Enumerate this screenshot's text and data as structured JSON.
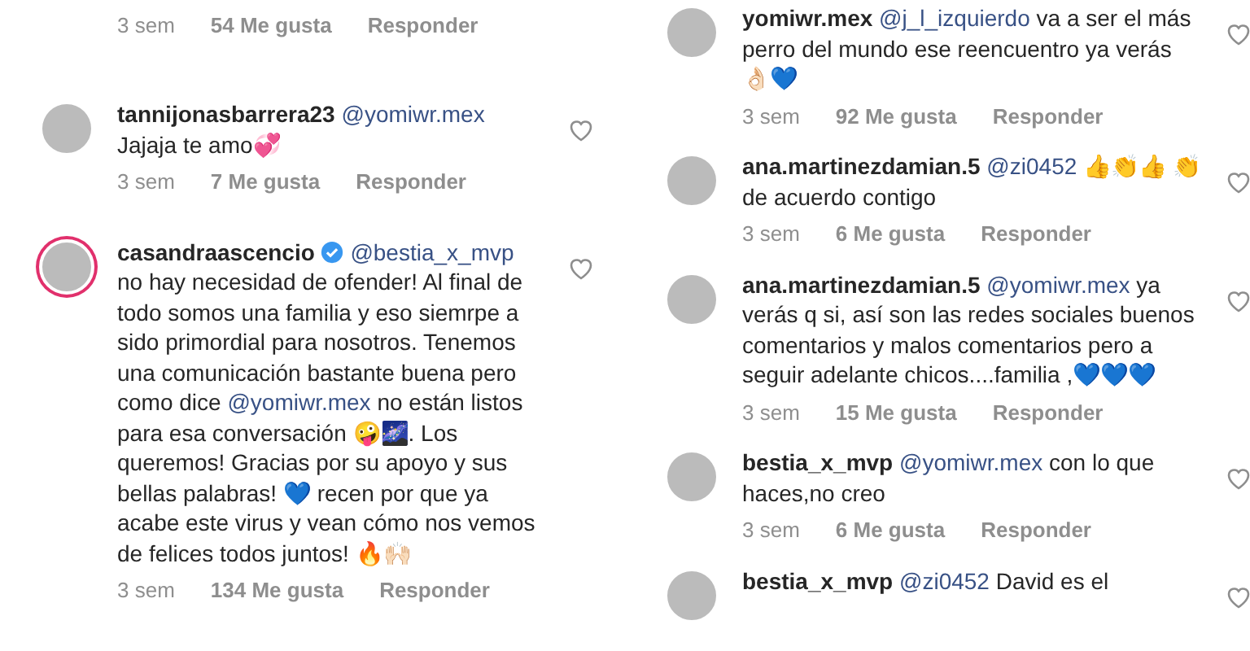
{
  "columns": [
    {
      "comments": [
        {
          "meta": {
            "time": "3 sem",
            "likes": "54 Me gusta",
            "reply": "Responder"
          }
        },
        {
          "username": "tannijonasbarrera23",
          "segments": [
            {
              "kind": "mention",
              "text": "@yomiwr.mex"
            },
            {
              "kind": "plain",
              "text": "Jajaja te amo💞"
            }
          ],
          "meta": {
            "time": "3 sem",
            "likes": "7 Me gusta",
            "reply": "Responder"
          }
        },
        {
          "username": "casandraascencio",
          "verified": true,
          "segments": [
            {
              "kind": "mention",
              "text": "@bestia_x_mvp"
            },
            {
              "kind": "plain",
              "text": "no hay necesidad de ofender! Al final de todo somos una familia y eso siemrpe a sido primordial para nosotros. Tenemos una comunicación bastante buena pero como dice"
            },
            {
              "kind": "mention",
              "text": "@yomiwr.mex"
            },
            {
              "kind": "plain",
              "text": "no están listos para esa conversación 🤪🌌. Los queremos! Gracias por su apoyo y sus bellas palabras! 💙 recen por que ya acabe este virus y vean cómo nos vemos de felices todos juntos! 🔥🙌🏻"
            }
          ],
          "meta": {
            "time": "3 sem",
            "likes": "134 Me gusta",
            "reply": "Responder"
          }
        }
      ]
    },
    {
      "comments": [
        {
          "username": "yomiwr.mex",
          "segments": [
            {
              "kind": "mention",
              "text": "@j_l_izquierdo"
            },
            {
              "kind": "plain",
              "text": "va a ser el más perro del mundo ese reencuentro ya verás 👌🏻💙"
            }
          ],
          "meta": {
            "time": "3 sem",
            "likes": "92 Me gusta",
            "reply": "Responder"
          }
        },
        {
          "username": "ana.martinezdamian.5",
          "segments": [
            {
              "kind": "mention",
              "text": "@zi0452"
            },
            {
              "kind": "plain",
              "text": "👍👏👍 👏 de acuerdo contigo"
            }
          ],
          "meta": {
            "time": "3 sem",
            "likes": "6 Me gusta",
            "reply": "Responder"
          }
        },
        {
          "username": "ana.martinezdamian.5",
          "segments": [
            {
              "kind": "mention",
              "text": "@yomiwr.mex"
            },
            {
              "kind": "plain",
              "text": "ya verás q si, así son las  redes sociales buenos comentarios y malos comentarios  pero a seguir adelante chicos....familia ,💙💙💙"
            }
          ],
          "meta": {
            "time": "3 sem",
            "likes": "15 Me gusta",
            "reply": "Responder"
          }
        },
        {
          "username": "bestia_x_mvp",
          "segments": [
            {
              "kind": "mention",
              "text": "@yomiwr.mex"
            },
            {
              "kind": "plain",
              "text": "con lo que haces,no creo"
            }
          ],
          "meta": {
            "time": "3 sem",
            "likes": "6 Me gusta",
            "reply": "Responder"
          }
        },
        {
          "username": "bestia_x_mvp",
          "segments": [
            {
              "kind": "mention",
              "text": "@zi0452"
            },
            {
              "kind": "plain",
              "text": "David es el"
            }
          ]
        }
      ]
    }
  ]
}
